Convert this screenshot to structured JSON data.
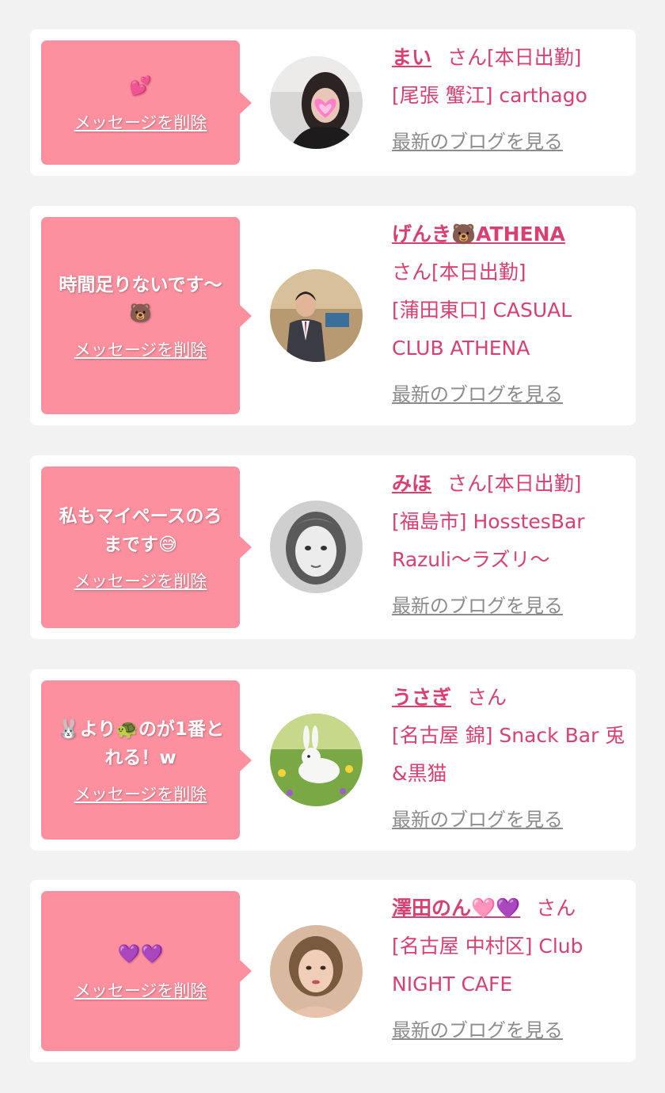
{
  "messages": [
    {
      "message": "💕",
      "delete_label": "メッセージを削除",
      "name": "まい",
      "honorific": "さん",
      "status": "[本日出勤]",
      "shop": "[尾張 蟹江] carthago",
      "blog_label": "最新のブログを見る",
      "avatar": "girl-photo-heart-sticker"
    },
    {
      "message": "時間足りないです〜🐻",
      "delete_label": "メッセージを削除",
      "name": "げんき🐻ATHENA",
      "honorific": "さん",
      "status": "[本日出勤]",
      "shop": "[蒲田東口] CASUAL CLUB ATHENA",
      "blog_label": "最新のブログを見る",
      "avatar": "man-in-suit-photo"
    },
    {
      "message": "私もマイペースのろまです😅",
      "delete_label": "メッセージを削除",
      "name": "みほ",
      "honorific": "さん",
      "status": "[本日出勤]",
      "shop": "[福島市] HosstesBar Razuli〜ラズリ〜",
      "blog_label": "最新のブログを見る",
      "avatar": "monochrome-girl-illustration"
    },
    {
      "message": "🐰より🐢のが1番とれる！w",
      "delete_label": "メッセージを削除",
      "name": "うさぎ",
      "honorific": "さん",
      "status": "",
      "shop": "[名古屋 錦] Snack Bar 兎&黒猫",
      "blog_label": "最新のブログを見る",
      "avatar": "white-rabbit-in-field"
    },
    {
      "message": "💜💜",
      "delete_label": "メッセージを削除",
      "name": "澤田のん🩷💜",
      "honorific": "さん",
      "status": "",
      "shop": "[名古屋 中村区] Club NIGHT CAFE",
      "blog_label": "最新のブログを見る",
      "avatar": "girl-portrait-photo"
    }
  ],
  "colors": {
    "background": "#f2f2f3",
    "card": "#ffffff",
    "bubble": "#fd909f",
    "name_text": "#d94071",
    "blog_link": "#8c8c8c"
  }
}
